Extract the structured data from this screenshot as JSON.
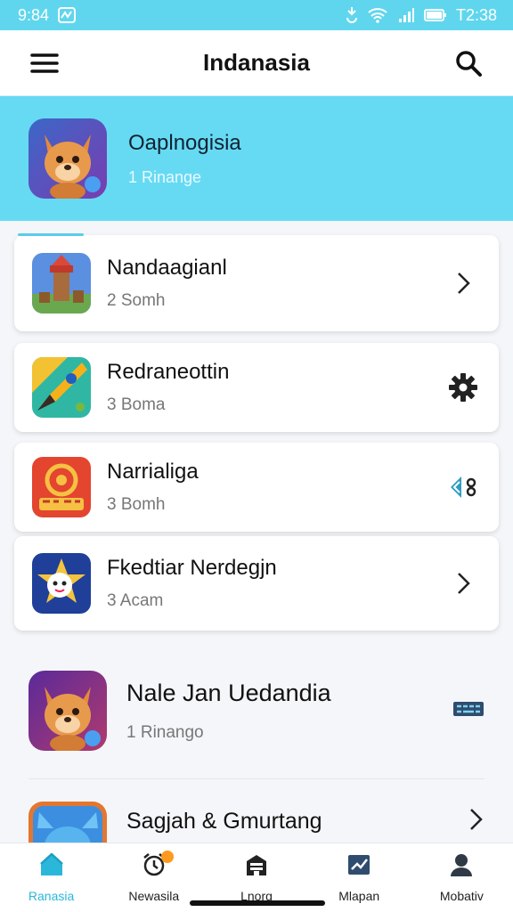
{
  "status": {
    "time": "9:84",
    "right_text": "T2:38"
  },
  "appbar": {
    "title": "Indanasia",
    "menu_icon": "hamburger-menu-icon",
    "search_icon": "search-icon"
  },
  "hero": {
    "name": "Oaplnogisia",
    "subtitle": "1 Rinange"
  },
  "cards": [
    {
      "name": "Nandaagianl",
      "subtitle": "2 Somh",
      "trail": "chevron-right-icon"
    },
    {
      "name": "Redraneottin",
      "subtitle": "3 Boma",
      "trail": "gear-icon"
    },
    {
      "name": "Narrialiga",
      "subtitle": "3 Bomh",
      "trail": "share-icon"
    },
    {
      "name": "Fkedtiar Nerdegjn",
      "subtitle": "3 Acam",
      "trail": "chevron-right-icon"
    }
  ],
  "rows": [
    {
      "name": "Nale Jan Uedandia",
      "subtitle": "1 Rinango",
      "trail": "keyboard-icon"
    },
    {
      "name": "Sagjah & Gmurtang",
      "subtitle": "",
      "trail": "chevron-right-icon"
    }
  ],
  "nav": [
    {
      "label": "Ranasia",
      "icon": "home-icon",
      "active": true
    },
    {
      "label": "Newasila",
      "icon": "alarm-icon",
      "active": false,
      "badge": true
    },
    {
      "label": "Lnorg",
      "icon": "building-icon",
      "active": false
    },
    {
      "label": "Mlapan",
      "icon": "map-icon",
      "active": false
    },
    {
      "label": "Mobativ",
      "icon": "profile-icon",
      "active": false
    }
  ],
  "colors": {
    "accent": "#59cde9",
    "hero_bg": "#66daf3",
    "badge": "#ff9a1f"
  }
}
